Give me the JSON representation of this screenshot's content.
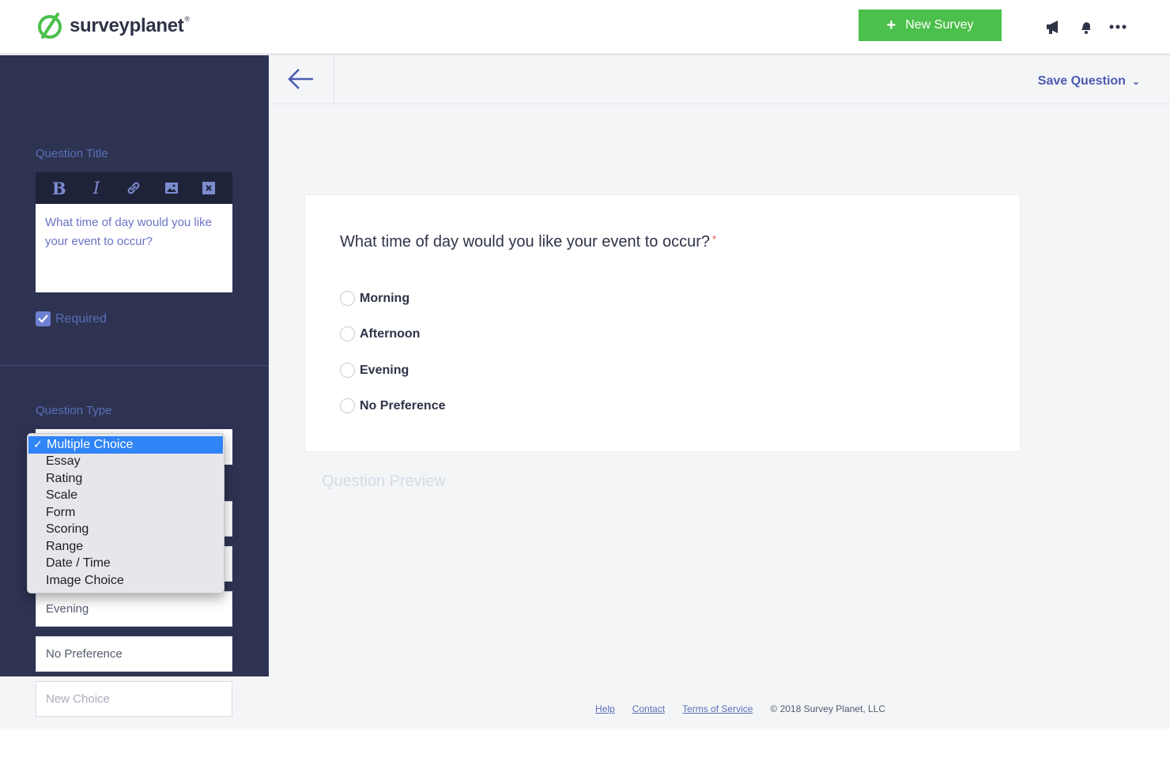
{
  "header": {
    "brand": "surveyplanet",
    "brand_mark": "®",
    "new_survey_label": "New Survey",
    "icons": [
      "megaphone-icon",
      "notification-bell-icon",
      "more-options-icon"
    ]
  },
  "sidebar": {
    "question_title_label": "Question Title",
    "toolbar": [
      "bold",
      "italic",
      "link",
      "image",
      "clear-format"
    ],
    "question_text": "What time of day would you like your event to occur?",
    "required_label": "Required",
    "required_checked": true,
    "question_type_label": "Question Type",
    "type_options": [
      "Multiple Choice",
      "Essay",
      "Rating",
      "Scale",
      "Form",
      "Scoring",
      "Range",
      "Date / Time",
      "Image Choice"
    ],
    "selected_type": "Multiple Choice",
    "choices": [
      "Evening",
      "No Preference"
    ],
    "new_choice_placeholder": "New Choice"
  },
  "main": {
    "save_label": "Save Question",
    "question": "What time of day would you like your event to occur?",
    "required_marker": "*",
    "options": [
      "Morning",
      "Afternoon",
      "Evening",
      "No Preference"
    ],
    "preview_label": "Question Preview"
  },
  "footer": {
    "links": [
      "Help",
      "Contact",
      "Terms of Service"
    ],
    "copyright": "© 2018 Survey Planet, LLC"
  },
  "colors": {
    "sidebar_bg": "#2e3352",
    "accent_green": "#4cc04c",
    "accent_blue": "#4a5bb0",
    "selection_blue": "#2f84f6"
  }
}
